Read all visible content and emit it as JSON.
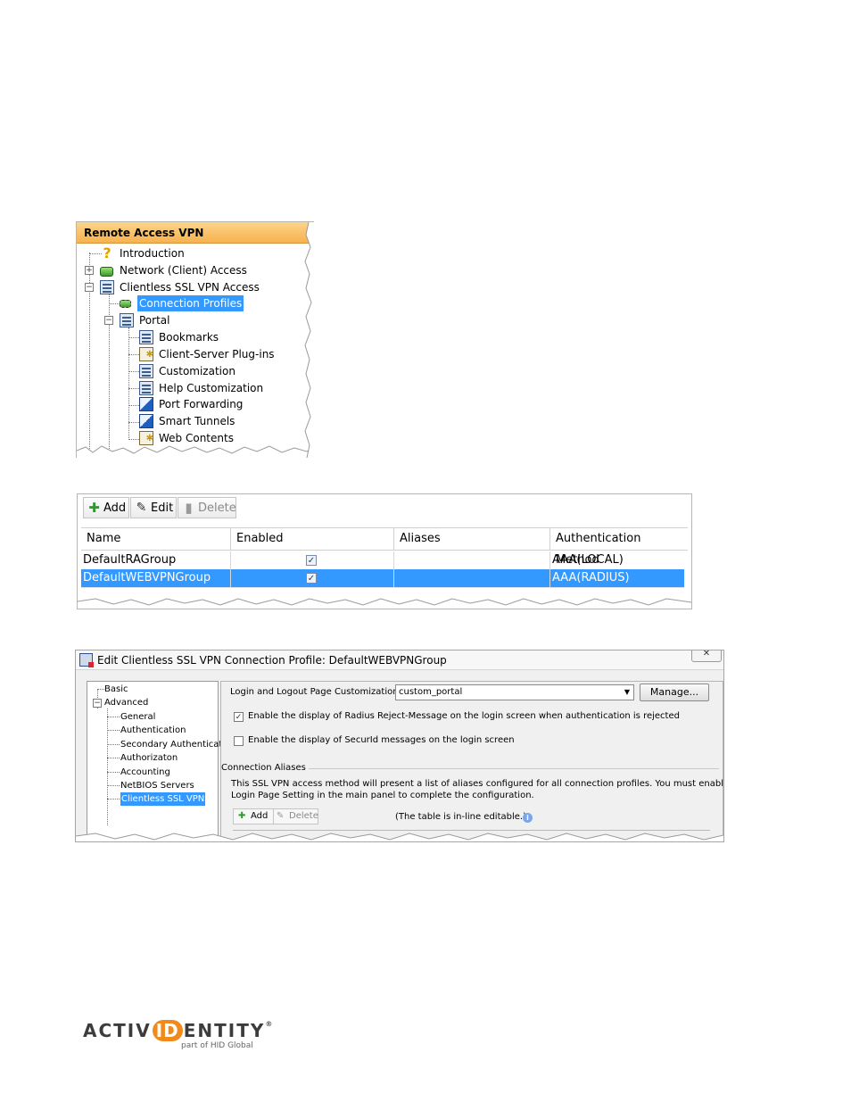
{
  "tree": {
    "header": "Remote Access VPN",
    "items": [
      {
        "label": "Introduction",
        "icon": "question-icon"
      },
      {
        "label": "Network (Client) Access",
        "icon": "plug-icon"
      },
      {
        "label": "Clientless SSL VPN Access",
        "icon": "grid-folder-icon"
      },
      {
        "label": "Connection Profiles",
        "icon": "plug-icon"
      },
      {
        "label": "Portal",
        "icon": "grid-folder-icon"
      },
      {
        "label": "Bookmarks",
        "icon": "list-icon"
      },
      {
        "label": "Client-Server Plug-ins",
        "icon": "plugin-star-icon"
      },
      {
        "label": "Customization",
        "icon": "list-icon"
      },
      {
        "label": "Help Customization",
        "icon": "list-icon"
      },
      {
        "label": "Port Forwarding",
        "icon": "arrow-icon"
      },
      {
        "label": "Smart Tunnels",
        "icon": "arrow-icon"
      },
      {
        "label": "Web Contents",
        "icon": "plugin-star-icon"
      }
    ],
    "selected": "Connection Profiles"
  },
  "table": {
    "toolbar": {
      "add": "Add",
      "edit": "Edit",
      "delete": "Delete"
    },
    "columns": [
      "Name",
      "Enabled",
      "Aliases",
      "Authentication Method"
    ],
    "rows": [
      {
        "name": "DefaultRAGroup",
        "enabled": true,
        "aliases": "",
        "auth": "AAA(LOCAL)"
      },
      {
        "name": "DefaultWEBVPNGroup",
        "enabled": true,
        "aliases": "",
        "auth": "AAA(RADIUS)"
      }
    ]
  },
  "dialog": {
    "title": "Edit Clientless SSL VPN Connection Profile: DefaultWEBVPNGroup",
    "close": "✕",
    "nav": {
      "basic": "Basic",
      "advanced": "Advanced",
      "children": [
        "General",
        "Authentication",
        "Secondary Authenticat",
        "Authorizaton",
        "Accounting",
        "NetBIOS Servers",
        "Clientless SSL VPN"
      ],
      "selected": "Clientless SSL VPN"
    },
    "customization_label": "Login and Logout Page Customization:",
    "customization_value": "custom_portal",
    "manage_button": "Manage...",
    "radius_reject_label": "Enable the display of Radius Reject-Message on the login screen when authentication is rejected",
    "radius_reject_checked": true,
    "securid_label": "Enable the display of SecurId messages on the login screen",
    "securid_checked": false,
    "aliases_section": "Connection Aliases",
    "aliases_desc_1": "This SSL VPN access method will present a list of aliases configured for all connection profiles. You must enable the",
    "aliases_desc_2": "Login Page Setting in the main panel to complete the configuration.",
    "add": "Add",
    "delete": "Delete",
    "inline_note": "(The table is in-line editable.)"
  },
  "logo": {
    "part1": "ACTIV",
    "part2": "ID",
    "part3": "ENTITY",
    "reg": "®",
    "sub": "part of HID Global"
  },
  "colors": {
    "selection": "#3399ff",
    "tree_header": "#f7b24e",
    "logo_accent": "#f08a1c"
  }
}
